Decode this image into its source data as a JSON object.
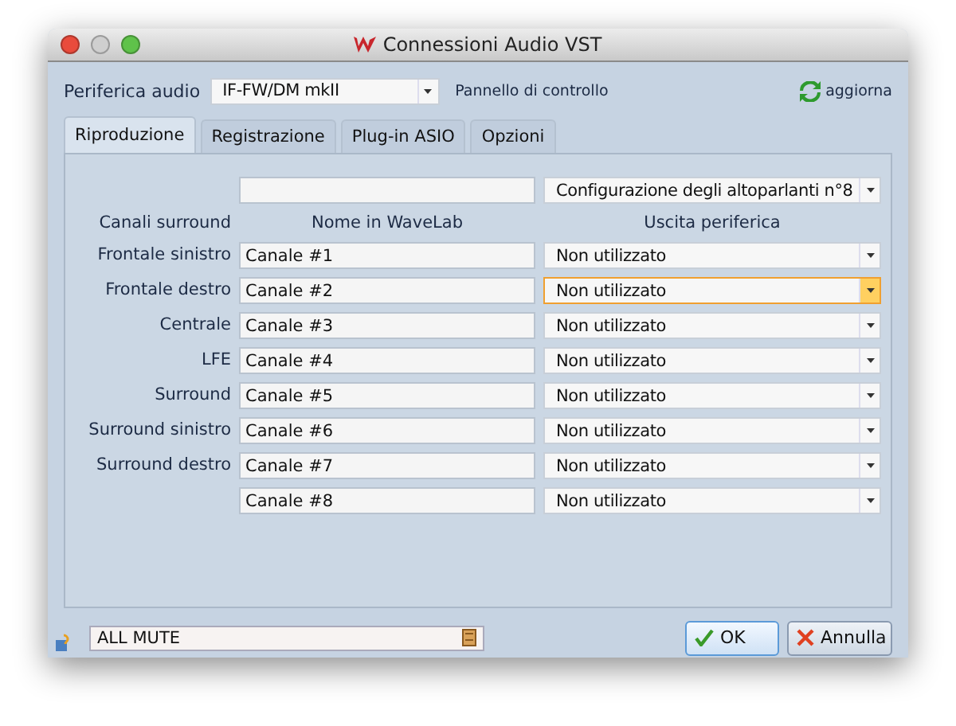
{
  "window": {
    "title": "Connessioni Audio VST"
  },
  "device": {
    "label": "Periferica audio",
    "value": "IF-FW/DM mkII",
    "control_panel": "Pannello di controllo",
    "refresh": "aggiorna"
  },
  "tabs": [
    {
      "label": "Riproduzione",
      "selected": true
    },
    {
      "label": "Registrazione",
      "selected": false
    },
    {
      "label": "Plug-in ASIO",
      "selected": false
    },
    {
      "label": "Opzioni",
      "selected": false
    }
  ],
  "configuration": "Configurazione degli altoparlanti n°8",
  "columns": [
    "Canali surround",
    "Nome in WaveLab",
    "Uscita periferica"
  ],
  "channels": [
    {
      "label": "Frontale sinistro",
      "name": "Canale #1",
      "output": "Non utilizzato",
      "focused": false
    },
    {
      "label": "Frontale destro",
      "name": "Canale #2",
      "output": "Non utilizzato",
      "focused": true
    },
    {
      "label": "Centrale",
      "name": "Canale #3",
      "output": "Non utilizzato",
      "focused": false
    },
    {
      "label": "LFE",
      "name": "Canale #4",
      "output": "Non utilizzato",
      "focused": false
    },
    {
      "label": "Surround",
      "name": "Canale #5",
      "output": "Non utilizzato",
      "focused": false
    },
    {
      "label": "Surround sinistro",
      "name": "Canale #6",
      "output": "Non utilizzato",
      "focused": false
    },
    {
      "label": "Surround destro",
      "name": "Canale #7",
      "output": "Non utilizzato",
      "focused": false
    },
    {
      "name": "Canale #8",
      "output": "Non utilizzato",
      "focused": false
    }
  ],
  "preset": "ALL MUTE",
  "buttons": [
    {
      "kind": "ok",
      "label": "OK"
    },
    {
      "kind": "cancel",
      "label": "Annulla"
    }
  ]
}
